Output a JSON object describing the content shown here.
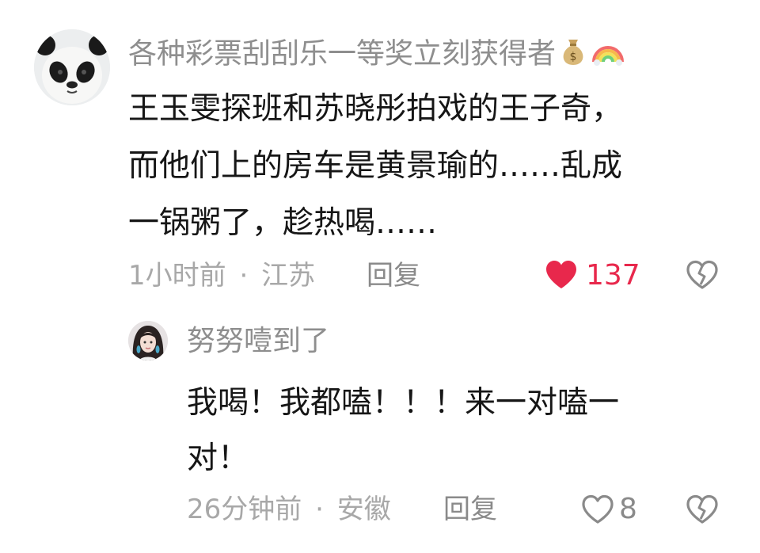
{
  "comment": {
    "username": "各种彩票刮刮乐一等奖立刻获得者",
    "badge_icons": [
      "money-bag-icon",
      "rainbow-icon"
    ],
    "text_lines": [
      "王玉雯探班和苏晓彤拍戏的王子奇，",
      "而他们上的房车是黄景瑜的……乱成",
      "一锅粥了，趁热喝……"
    ],
    "time": "1小时前",
    "separator": "·",
    "location": "江苏",
    "reply_label": "回复",
    "likes": "137",
    "liked": true,
    "like_color": "#e8284c"
  },
  "reply": {
    "username": "努努噎到了",
    "text_lines": [
      "我喝！我都嗑！！！来一对嗑一",
      "对！"
    ],
    "time": "26分钟前",
    "separator": "·",
    "location": "安徽",
    "reply_label": "回复",
    "likes": "8",
    "liked": false
  }
}
